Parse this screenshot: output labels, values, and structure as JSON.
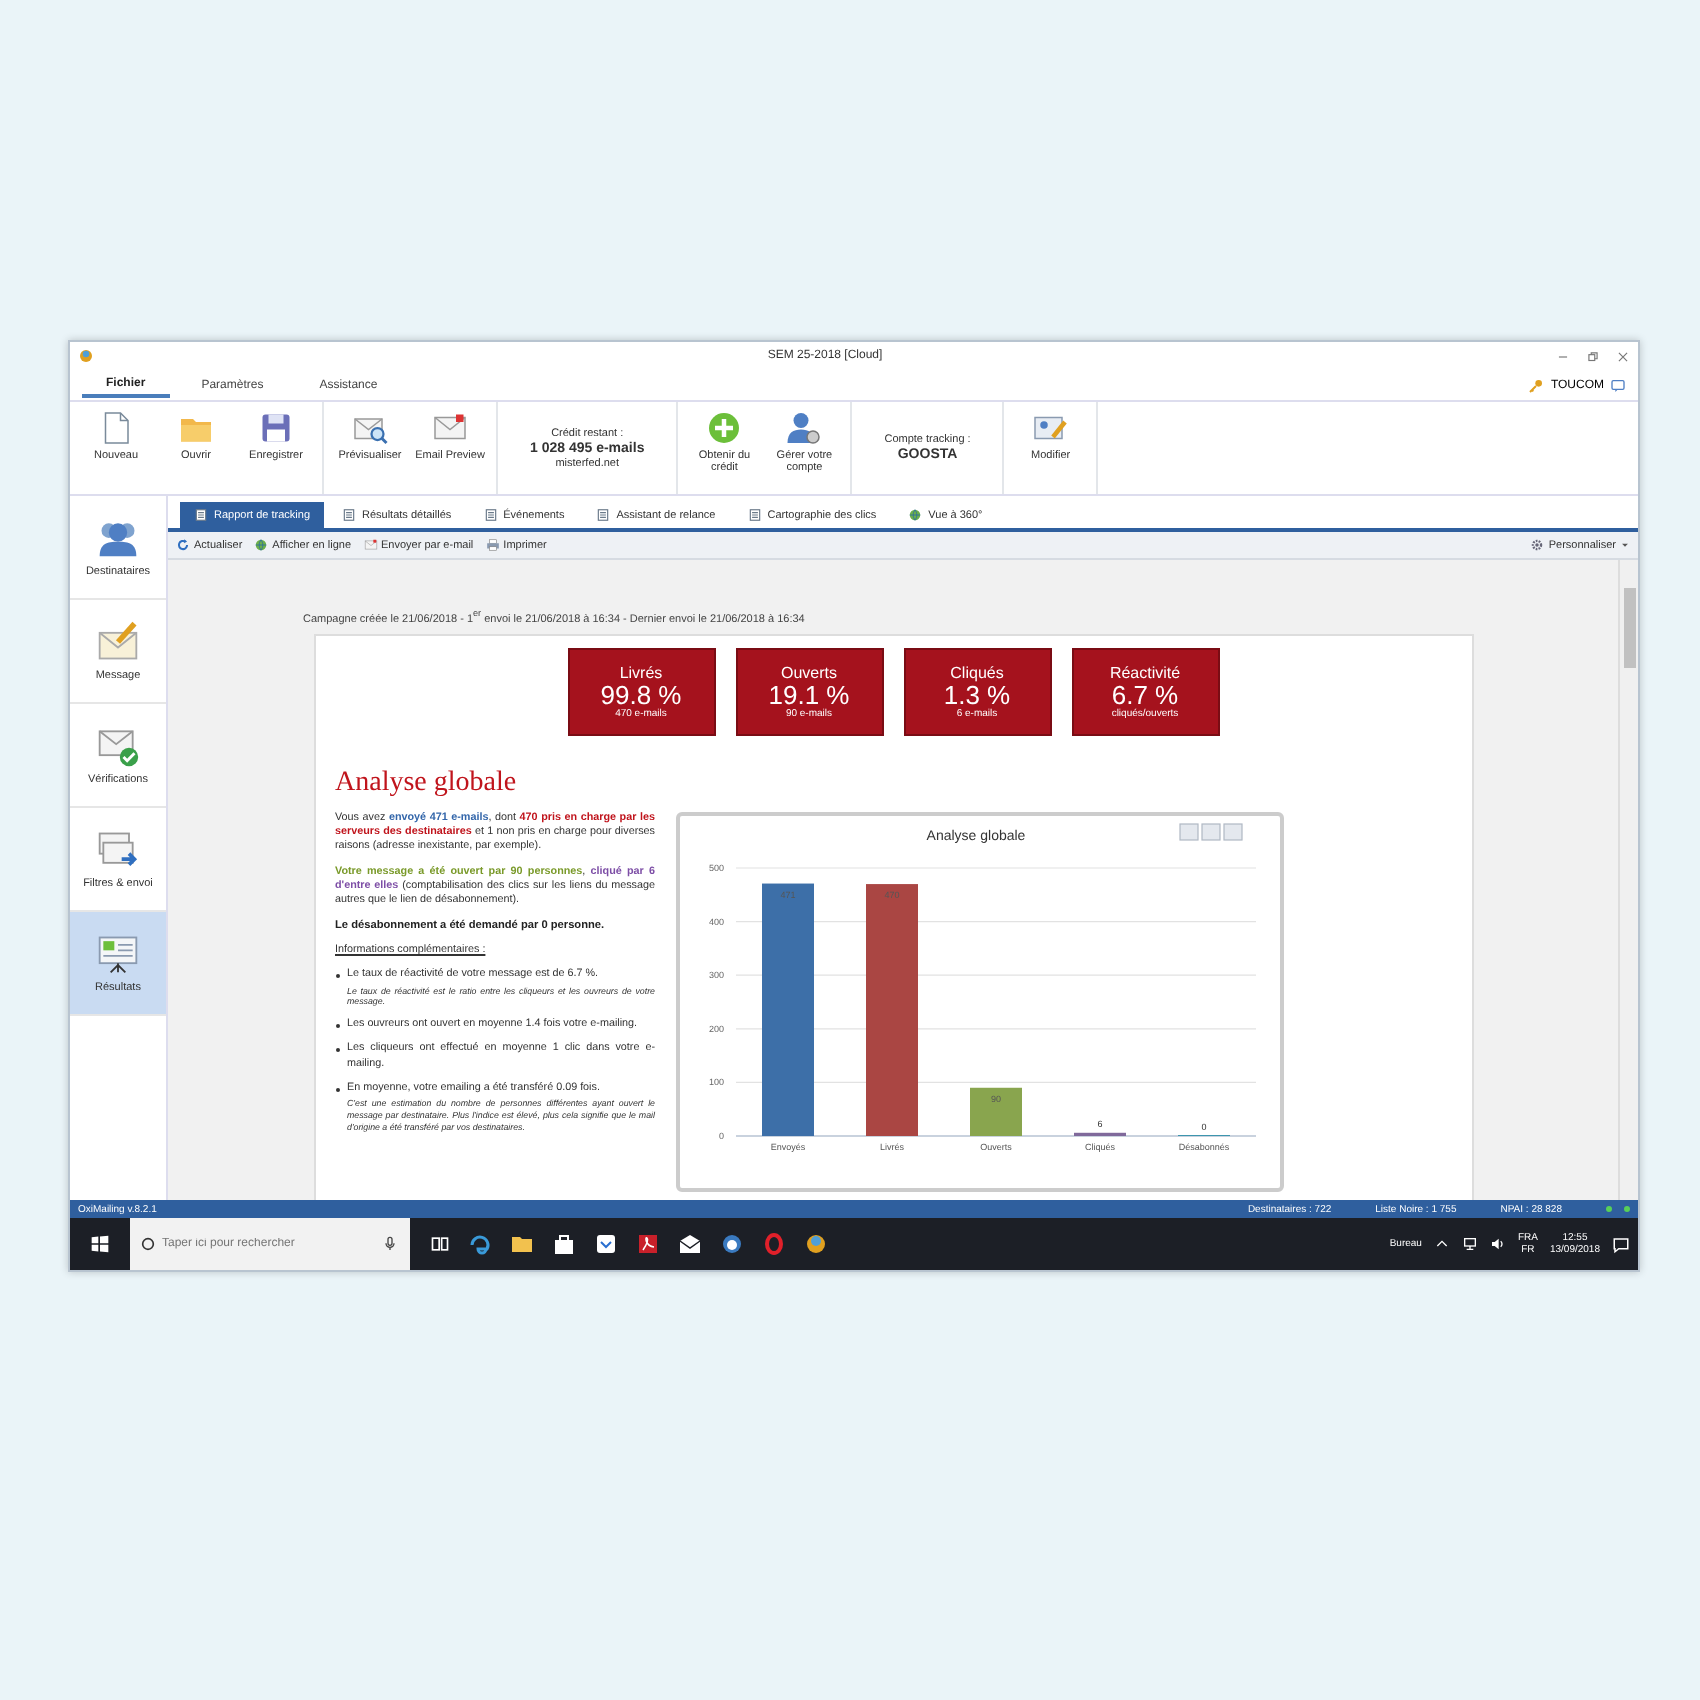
{
  "window": {
    "title": "SEM 25-2018 [Cloud]"
  },
  "menu_tabs": [
    {
      "label": "Fichier",
      "selected": true
    },
    {
      "label": "Paramètres",
      "selected": false
    },
    {
      "label": "Assistance",
      "selected": false
    }
  ],
  "user": {
    "label": "TOUCOM"
  },
  "ribbon": [
    {
      "kind": "buttons",
      "buttons": [
        {
          "label": "Nouveau"
        },
        {
          "label": "Ouvrir"
        },
        {
          "label": "Enregistrer"
        }
      ]
    },
    {
      "kind": "buttons",
      "buttons": [
        {
          "label": "Prévisualiser"
        },
        {
          "label": "Email Preview"
        }
      ]
    },
    {
      "kind": "info",
      "label": "Crédit restant :",
      "value": "1 028 495 e-mails",
      "sub": "misterfed.net"
    },
    {
      "kind": "buttons",
      "buttons": [
        {
          "label": "Obtenir du crédit"
        },
        {
          "label": "Gérer votre compte"
        }
      ]
    },
    {
      "kind": "info",
      "label": "Compte tracking :",
      "value": "GOOSTA"
    },
    {
      "kind": "buttons",
      "buttons": [
        {
          "label": "Modifier"
        }
      ]
    }
  ],
  "sidebar": [
    {
      "label": "Destinataires",
      "selected": false
    },
    {
      "label": "Message",
      "selected": false
    },
    {
      "label": "Vérifications",
      "selected": false
    },
    {
      "label": "Filtres & envoi",
      "selected": false
    },
    {
      "label": "Résultats",
      "selected": true
    }
  ],
  "tabs": [
    {
      "label": "Rapport de tracking",
      "selected": true
    },
    {
      "label": "Résultats détaillés",
      "selected": false
    },
    {
      "label": "Événements",
      "selected": false
    },
    {
      "label": "Assistant de relance",
      "selected": false
    },
    {
      "label": "Cartographie des clics",
      "selected": false
    },
    {
      "label": "Vue à 360°",
      "selected": false
    }
  ],
  "toolbar": {
    "items": [
      {
        "label": "Actualiser"
      },
      {
        "label": "Afficher en ligne"
      },
      {
        "label": "Envoyer par e-mail"
      },
      {
        "label": "Imprimer"
      }
    ],
    "menu": "Personnaliser"
  },
  "report": {
    "meta": "Campagne créée le 21/06/2018 - 1$^{er}$ envoi le 21/06/2018 à 16:34 - Dernier envoi le 21/06/2018 à 16:34",
    "cards": [
      {
        "title": "Livrés",
        "value": "99.8 %",
        "sub": "470 e-mails"
      },
      {
        "title": "Ouverts",
        "value": "19.1 %",
        "sub": "90 e-mails"
      },
      {
        "title": "Cliqués",
        "value": "1.3 %",
        "sub": "6 e-mails"
      },
      {
        "title": "Réactivité",
        "value": "6.7 %",
        "sub": "cliqués/ouverts"
      }
    ],
    "heading": "Analyse globale",
    "paragraphs": [
      [
        {
          "text": "Vous avez "
        },
        {
          "text": "**envoyé 471 e-mails**",
          "color": "#3366aa"
        },
        {
          "text": ", dont "
        },
        {
          "text": "**470 pris en charge par les serveurs des destinataires**",
          "color": "#c0141c"
        },
        {
          "text": " et 1 non pris en charge pour diverses raisons (adresse inexistante, par exemple)."
        }
      ],
      [
        {
          "text": "**Votre message a été ouvert par 90 personnes**",
          "color": "#7a9a2a"
        },
        {
          "text": ", "
        },
        {
          "text": "**cliqué par 6 d'entre elles**",
          "color": "#7d4ea6"
        },
        {
          "text": " (comptabilisation des clics sur les liens du message autres que le lien de désabonnement)."
        }
      ]
    ],
    "unsubscribe": "Le désabonnement a été demandé par 0 personne.",
    "info_title": "Informations complémentaires :",
    "info": [
      {
        "text": "Le taux de réactivité de votre message est de 6.7 %.",
        "note": "Le taux de réactivité est le ratio entre les cliqueurs et les ouvreurs de votre message."
      },
      {
        "text": "Les ouvreurs ont ouvert en moyenne 1.4 fois votre e-mailing."
      },
      {
        "text": "Les cliqueurs ont effectué en moyenne 1 clic dans votre e-mailing."
      },
      {
        "text": "En moyenne, votre emailing a été transféré 0.09 fois.",
        "note": "C'est une estimation du nombre de personnes différentes ayant ouvert le message par destinataire. Plus l'indice est élevé, plus cela signifie que le mail d'origine a été transféré par vos destinataires."
      }
    ],
    "chart_data": {
      "type": "bar",
      "title": "Analyse globale",
      "grid": true,
      "series": [
        {
          "name": "Envoyés",
          "color": "#3d6fa8",
          "values": [
            471,
            null,
            null,
            null,
            null
          ]
        },
        {
          "name": "Livrés",
          "color": "#aa4643",
          "values": [
            null,
            470,
            null,
            null,
            null
          ]
        },
        {
          "name": "Ouverts",
          "color": "#89a54e",
          "values": [
            null,
            null,
            90,
            null,
            null
          ]
        },
        {
          "name": "Cliqués",
          "color": "#80699b",
          "values": [
            null,
            null,
            null,
            6,
            null
          ]
        },
        {
          "name": "Désabonnés",
          "color": "#3d96ae",
          "values": [
            null,
            null,
            null,
            null,
            0
          ]
        }
      ],
      "ylim": [
        0,
        500
      ],
      "yticks": [
        0,
        100,
        200,
        300,
        400,
        500
      ],
      "data_labels": true
    }
  },
  "status_bar": {
    "app": "OxiMailing v.8.2.1",
    "items": [
      "Destinataires : 722",
      "Liste Noire : 1 755",
      "NPAI : 28 828"
    ]
  },
  "taskbar": {
    "search_placeholder": "Taper ici pour rechercher",
    "desktop": "Bureau",
    "lang": "FRA",
    "layout": "FR",
    "time": "12:55",
    "date": "13/09/2018"
  }
}
